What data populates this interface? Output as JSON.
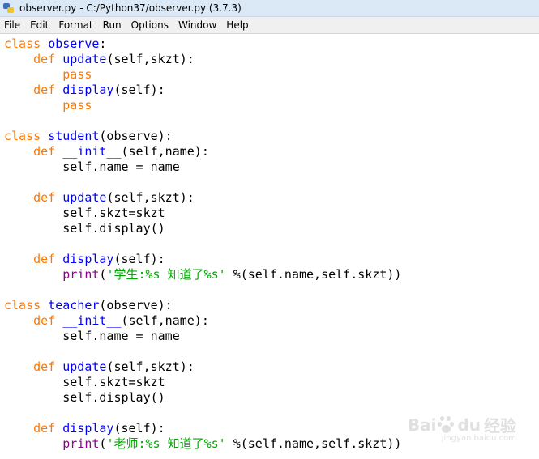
{
  "window": {
    "title": "observer.py - C:/Python37/observer.py (3.7.3)"
  },
  "menu": [
    "File",
    "Edit",
    "Format",
    "Run",
    "Options",
    "Window",
    "Help"
  ],
  "code": [
    [
      [
        "kw",
        "class"
      ],
      [
        "n",
        " "
      ],
      [
        "def",
        "observe"
      ],
      [
        "n",
        ":"
      ]
    ],
    [
      [
        "n",
        "    "
      ],
      [
        "kw",
        "def"
      ],
      [
        "n",
        " "
      ],
      [
        "def",
        "update"
      ],
      [
        "n",
        "(self,skzt):"
      ]
    ],
    [
      [
        "n",
        "        "
      ],
      [
        "kw",
        "pass"
      ]
    ],
    [
      [
        "n",
        "    "
      ],
      [
        "kw",
        "def"
      ],
      [
        "n",
        " "
      ],
      [
        "def",
        "display"
      ],
      [
        "n",
        "(self):"
      ]
    ],
    [
      [
        "n",
        "        "
      ],
      [
        "kw",
        "pass"
      ]
    ],
    [],
    [
      [
        "kw",
        "class"
      ],
      [
        "n",
        " "
      ],
      [
        "def",
        "student"
      ],
      [
        "n",
        "(observe):"
      ]
    ],
    [
      [
        "n",
        "    "
      ],
      [
        "kw",
        "def"
      ],
      [
        "n",
        " "
      ],
      [
        "def",
        "__init__"
      ],
      [
        "n",
        "(self,name):"
      ]
    ],
    [
      [
        "n",
        "        self.name = name"
      ]
    ],
    [],
    [
      [
        "n",
        "    "
      ],
      [
        "kw",
        "def"
      ],
      [
        "n",
        " "
      ],
      [
        "def",
        "update"
      ],
      [
        "n",
        "(self,skzt):"
      ]
    ],
    [
      [
        "n",
        "        self.skzt=skzt"
      ]
    ],
    [
      [
        "n",
        "        self.display()"
      ]
    ],
    [],
    [
      [
        "n",
        "    "
      ],
      [
        "kw",
        "def"
      ],
      [
        "n",
        " "
      ],
      [
        "def",
        "display"
      ],
      [
        "n",
        "(self):"
      ]
    ],
    [
      [
        "n",
        "        "
      ],
      [
        "bi",
        "print"
      ],
      [
        "n",
        "("
      ],
      [
        "str",
        "'学生:%s 知道了%s'"
      ],
      [
        "n",
        " %(self.name,self.skzt))"
      ]
    ],
    [],
    [
      [
        "kw",
        "class"
      ],
      [
        "n",
        " "
      ],
      [
        "def",
        "teacher"
      ],
      [
        "n",
        "(observe):"
      ]
    ],
    [
      [
        "n",
        "    "
      ],
      [
        "kw",
        "def"
      ],
      [
        "n",
        " "
      ],
      [
        "def",
        "__init__"
      ],
      [
        "n",
        "(self,name):"
      ]
    ],
    [
      [
        "n",
        "        self.name = name"
      ]
    ],
    [],
    [
      [
        "n",
        "    "
      ],
      [
        "kw",
        "def"
      ],
      [
        "n",
        " "
      ],
      [
        "def",
        "update"
      ],
      [
        "n",
        "(self,skzt):"
      ]
    ],
    [
      [
        "n",
        "        self.skzt=skzt"
      ]
    ],
    [
      [
        "n",
        "        self.display()"
      ]
    ],
    [],
    [
      [
        "n",
        "    "
      ],
      [
        "kw",
        "def"
      ],
      [
        "n",
        " "
      ],
      [
        "def",
        "display"
      ],
      [
        "n",
        "(self):"
      ]
    ],
    [
      [
        "n",
        "        "
      ],
      [
        "bi",
        "print"
      ],
      [
        "n",
        "("
      ],
      [
        "str",
        "'老师:%s 知道了%s'"
      ],
      [
        "n",
        " %(self.name,self.skzt))"
      ]
    ]
  ],
  "colors": {
    "keyword": "#ff7700",
    "definition": "#0000ff",
    "string": "#00aa00",
    "builtin": "#900090"
  },
  "watermark": {
    "brand": "Bai",
    "brand2": "du",
    "text": "经验",
    "sub": "jingyan.baidu.com"
  }
}
